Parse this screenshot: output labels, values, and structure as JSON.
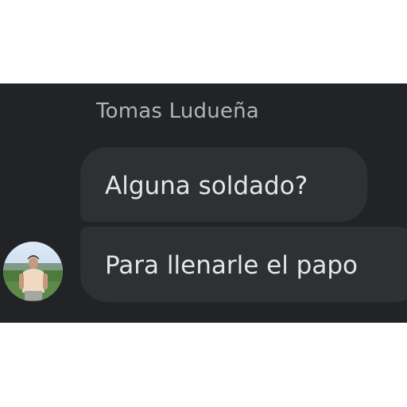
{
  "chat": {
    "sender_name": "Tomas Ludueña",
    "messages": [
      {
        "text": "Alguna soldado?"
      },
      {
        "text": "Para llenarle el papo"
      }
    ]
  },
  "colors": {
    "panel_background": "#222326",
    "bubble_background": "#2f3033",
    "message_text": "#e4e6eb",
    "sender_text": "#b0b3b8"
  },
  "icons": {
    "avatar": "user-profile-photo"
  }
}
